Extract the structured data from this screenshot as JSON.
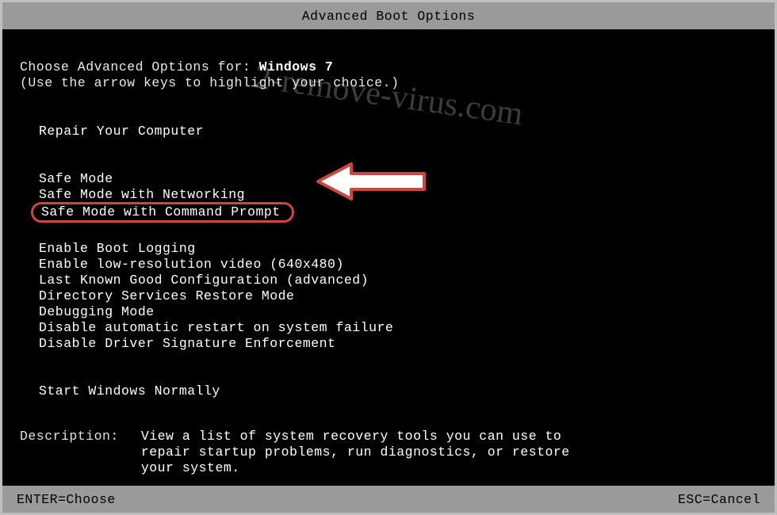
{
  "title": "Advanced Boot Options",
  "intro_prefix": "Choose Advanced Options for: ",
  "os_name": "Windows 7",
  "instruction": "(Use the arrow keys to highlight your choice.)",
  "groups": {
    "repair": "Repair Your Computer",
    "safemode": [
      "Safe Mode",
      "Safe Mode with Networking",
      "Safe Mode with Command Prompt"
    ],
    "options": [
      "Enable Boot Logging",
      "Enable low-resolution video (640x480)",
      "Last Known Good Configuration (advanced)",
      "Directory Services Restore Mode",
      "Debugging Mode",
      "Disable automatic restart on system failure",
      "Disable Driver Signature Enforcement"
    ],
    "normal": "Start Windows Normally"
  },
  "selected_index_in_safemode": 2,
  "description": {
    "label": "Description:",
    "text": "View a list of system recovery tools you can use to repair startup problems, run diagnostics, or restore your system."
  },
  "footer": {
    "left": "ENTER=Choose",
    "right": "ESC=Cancel"
  },
  "watermark": "2-remove-virus.com",
  "annotation_arrow": {
    "points_to": "Safe Mode with Command Prompt",
    "color_outline": "#d0463d",
    "color_fill": "#ffffff"
  }
}
